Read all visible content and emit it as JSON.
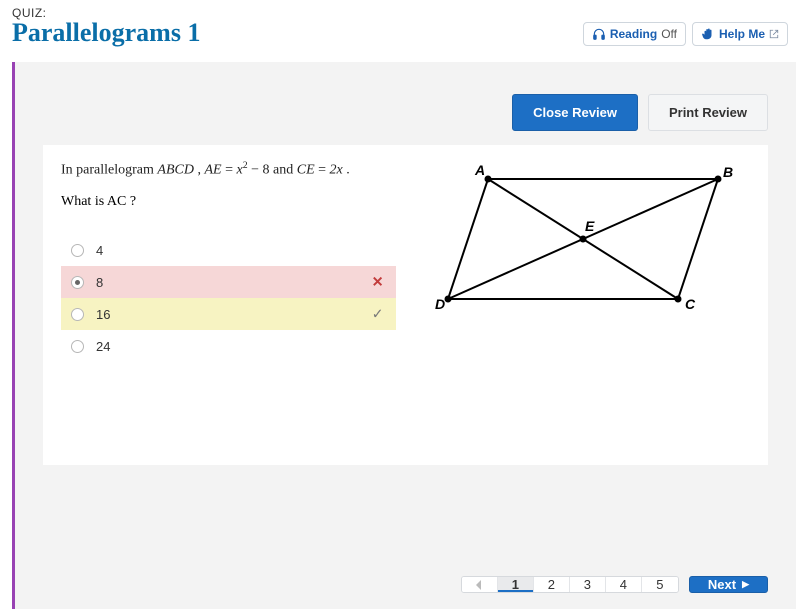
{
  "header": {
    "eyebrow": "QUIZ:",
    "title": "Parallelograms 1",
    "reading_label": "Reading",
    "reading_state": "Off",
    "help_label": "Help Me"
  },
  "review": {
    "close_label": "Close Review",
    "print_label": "Print Review"
  },
  "question": {
    "prompt_prefix": "In parallelogram ",
    "shape": "ABCD",
    "sep1": " , ",
    "ae_var": "AE",
    "eq1": " = ",
    "ae_expr_base": "x",
    "ae_expr_sup": "2",
    "ae_expr_tail": " − 8",
    "and": " and ",
    "ce_var": "CE",
    "eq2": " = ",
    "ce_expr": "2x",
    "period": " .",
    "sub_prefix": "What is ",
    "sub_var": "AC",
    "sub_suffix": " ?"
  },
  "choices": [
    {
      "label": "4",
      "selected": false,
      "status": ""
    },
    {
      "label": "8",
      "selected": true,
      "status": "wrong"
    },
    {
      "label": "16",
      "selected": false,
      "status": "correct"
    },
    {
      "label": "24",
      "selected": false,
      "status": ""
    }
  ],
  "figure": {
    "A": "A",
    "B": "B",
    "C": "C",
    "D": "D",
    "E": "E"
  },
  "pager": {
    "pages": [
      "1",
      "2",
      "3",
      "4",
      "5"
    ],
    "active": "1",
    "next_label": "Next"
  },
  "marks": {
    "x": "✕",
    "check": "✓"
  }
}
